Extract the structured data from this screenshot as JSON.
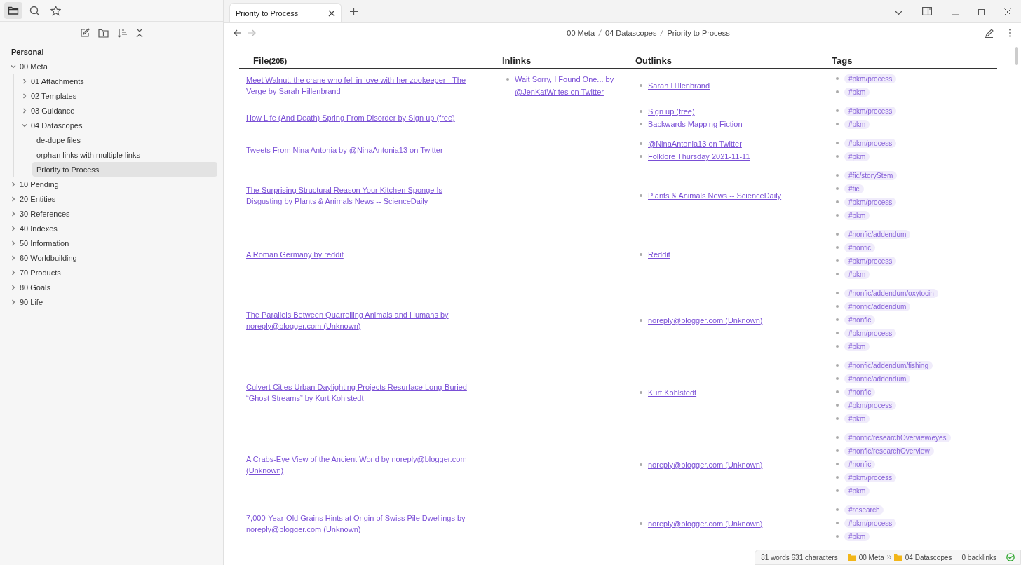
{
  "sidebar": {
    "tabs": [
      {
        "selected": true
      },
      {
        "selected": false
      },
      {
        "selected": false
      }
    ],
    "vault": "Personal",
    "tree": [
      {
        "kind": "folder",
        "label": "00 Meta",
        "expanded": true,
        "selected": false,
        "children": [
          {
            "kind": "folder",
            "label": "01 Attachments",
            "expanded": false,
            "selected": false
          },
          {
            "kind": "folder",
            "label": "02 Templates",
            "expanded": false,
            "selected": false
          },
          {
            "kind": "folder",
            "label": "03 Guidance",
            "expanded": false,
            "selected": false
          },
          {
            "kind": "folder",
            "label": "04 Datascopes",
            "expanded": true,
            "selected": false,
            "children": [
              {
                "kind": "file",
                "label": "de-dupe files",
                "selected": false
              },
              {
                "kind": "file",
                "label": "orphan links with multiple links",
                "selected": false
              },
              {
                "kind": "file",
                "label": "Priority to Process",
                "selected": true
              }
            ]
          }
        ]
      },
      {
        "kind": "folder",
        "label": "10 Pending",
        "expanded": false,
        "selected": false
      },
      {
        "kind": "folder",
        "label": "20 Entities",
        "expanded": false,
        "selected": false
      },
      {
        "kind": "folder",
        "label": "30 References",
        "expanded": false,
        "selected": false
      },
      {
        "kind": "folder",
        "label": "40 Indexes",
        "expanded": false,
        "selected": false
      },
      {
        "kind": "folder",
        "label": "50 Information",
        "expanded": false,
        "selected": false
      },
      {
        "kind": "folder",
        "label": "60 Worldbuilding",
        "expanded": false,
        "selected": false
      },
      {
        "kind": "folder",
        "label": "70 Products",
        "expanded": false,
        "selected": false
      },
      {
        "kind": "folder",
        "label": "80 Goals",
        "expanded": false,
        "selected": false
      },
      {
        "kind": "folder",
        "label": "90 Life",
        "expanded": false,
        "selected": false
      }
    ]
  },
  "tabs": [
    {
      "title": "Priority to Process",
      "selected": true
    }
  ],
  "breadcrumb": [
    "00 Meta",
    "04 Datascopes",
    "Priority to Process"
  ],
  "table": {
    "columns": [
      {
        "label": "File",
        "count": "(205)"
      },
      {
        "label": "Inlinks"
      },
      {
        "label": "Outlinks"
      },
      {
        "label": "Tags"
      }
    ],
    "rows": [
      {
        "file": "Meet Walnut, the crane who fell in love with her zookeeper - The Verge by Sarah Hillenbrand",
        "inlinks": [
          "Wait Sorry, I Found One... by @JenKatWrites on Twitter"
        ],
        "outlinks": [
          "Sarah Hillenbrand"
        ],
        "tags": [
          "#pkm/process",
          "#pkm"
        ]
      },
      {
        "file": "How Life (And Death) Spring From Disorder by Sign up (free)",
        "outlinks": [
          "Sign up (free)",
          "Backwards Mapping Fiction"
        ],
        "tags": [
          "#pkm/process",
          "#pkm"
        ]
      },
      {
        "file": "Tweets From Nina Antonia by @NinaAntonia13 on Twitter",
        "outlinks": [
          "@NinaAntonia13 on Twitter",
          "Folklore Thursday 2021-11-11"
        ],
        "tags": [
          "#pkm/process",
          "#pkm"
        ]
      },
      {
        "file": "The Surprising Structural Reason Your Kitchen Sponge Is Disgusting by Plants & Animals News -- ScienceDaily",
        "outlinks": [
          "Plants & Animals News -- ScienceDaily"
        ],
        "tags": [
          "#fic/storyStem",
          "#fic",
          "#pkm/process",
          "#pkm"
        ]
      },
      {
        "file": "A Roman Germany by reddit",
        "outlinks": [
          "Reddit"
        ],
        "tags": [
          "#nonfic/addendum",
          "#nonfic",
          "#pkm/process",
          "#pkm"
        ]
      },
      {
        "file": "The Parallels Between Quarrelling Animals and Humans by noreply@blogger.com (Unknown)",
        "outlinks": [
          "noreply@blogger.com (Unknown)"
        ],
        "tags": [
          "#nonfic/addendum/oxytocin",
          "#nonfic/addendum",
          "#nonfic",
          "#pkm/process",
          "#pkm"
        ]
      },
      {
        "file": "Culvert Cities Urban Daylighting Projects Resurface Long-Buried “Ghost Streams” by Kurt Kohlstedt",
        "outlinks": [
          "Kurt Kohlstedt"
        ],
        "tags": [
          "#nonfic/addendum/fishing",
          "#nonfic/addendum",
          "#nonfic",
          "#pkm/process",
          "#pkm"
        ]
      },
      {
        "file": "A Crabs-Eye View of the Ancient World by noreply@blogger.com (Unknown)",
        "outlinks": [
          "noreply@blogger.com (Unknown)"
        ],
        "tags": [
          "#nonfic/researchOverview/eyes",
          "#nonfic/researchOverview",
          "#nonfic",
          "#pkm/process",
          "#pkm"
        ]
      },
      {
        "file": "7,000-Year-Old Grains Hints at Origin of Swiss Pile Dwellings by noreply@blogger.com (Unknown)",
        "outlinks": [
          "noreply@blogger.com (Unknown)"
        ],
        "tags": [
          "#research",
          "#pkm/process",
          "#pkm"
        ]
      }
    ]
  },
  "status_bar": {
    "counts": "81 words 631 characters",
    "path": [
      "00 Meta",
      "04 Datascopes"
    ],
    "backlinks": "0 backlinks"
  }
}
